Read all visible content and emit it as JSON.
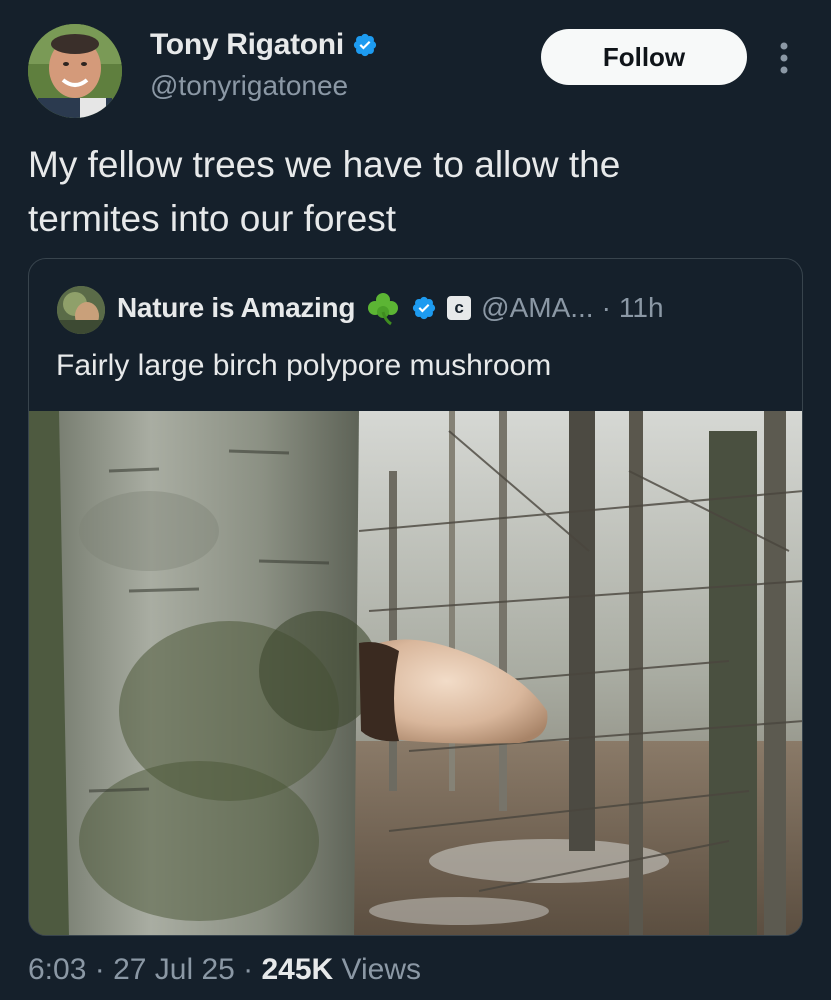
{
  "author": {
    "name": "Tony Rigatoni",
    "handle": "@tonyrigatonee",
    "verified": true,
    "verified_color": "#1d9bf0"
  },
  "actions": {
    "follow_label": "Follow",
    "more_icon": "more-dots-icon"
  },
  "tweet": {
    "text_line1": "My fellow trees we have to allow the",
    "text_line2": "termites into our forest"
  },
  "quote": {
    "name": "Nature is Amazing",
    "emoji_icon": "shamrock-icon",
    "badge_letter": "c",
    "handle": "@AMA...",
    "separator": "·",
    "time": "11h",
    "text": "Fairly large birch polypore mushroom",
    "image_icon": "tree-mushroom-photo"
  },
  "footer": {
    "time": "6:03",
    "sep1": " · ",
    "date": "27 Jul 25",
    "sep2": " · ",
    "views_count": "245K",
    "views_label": " Views"
  },
  "colors": {
    "background": "#15202b",
    "text_primary": "#e7e9ea",
    "text_secondary": "#8b98a5",
    "border": "#38444d",
    "button_bg": "#f7f9f9"
  }
}
